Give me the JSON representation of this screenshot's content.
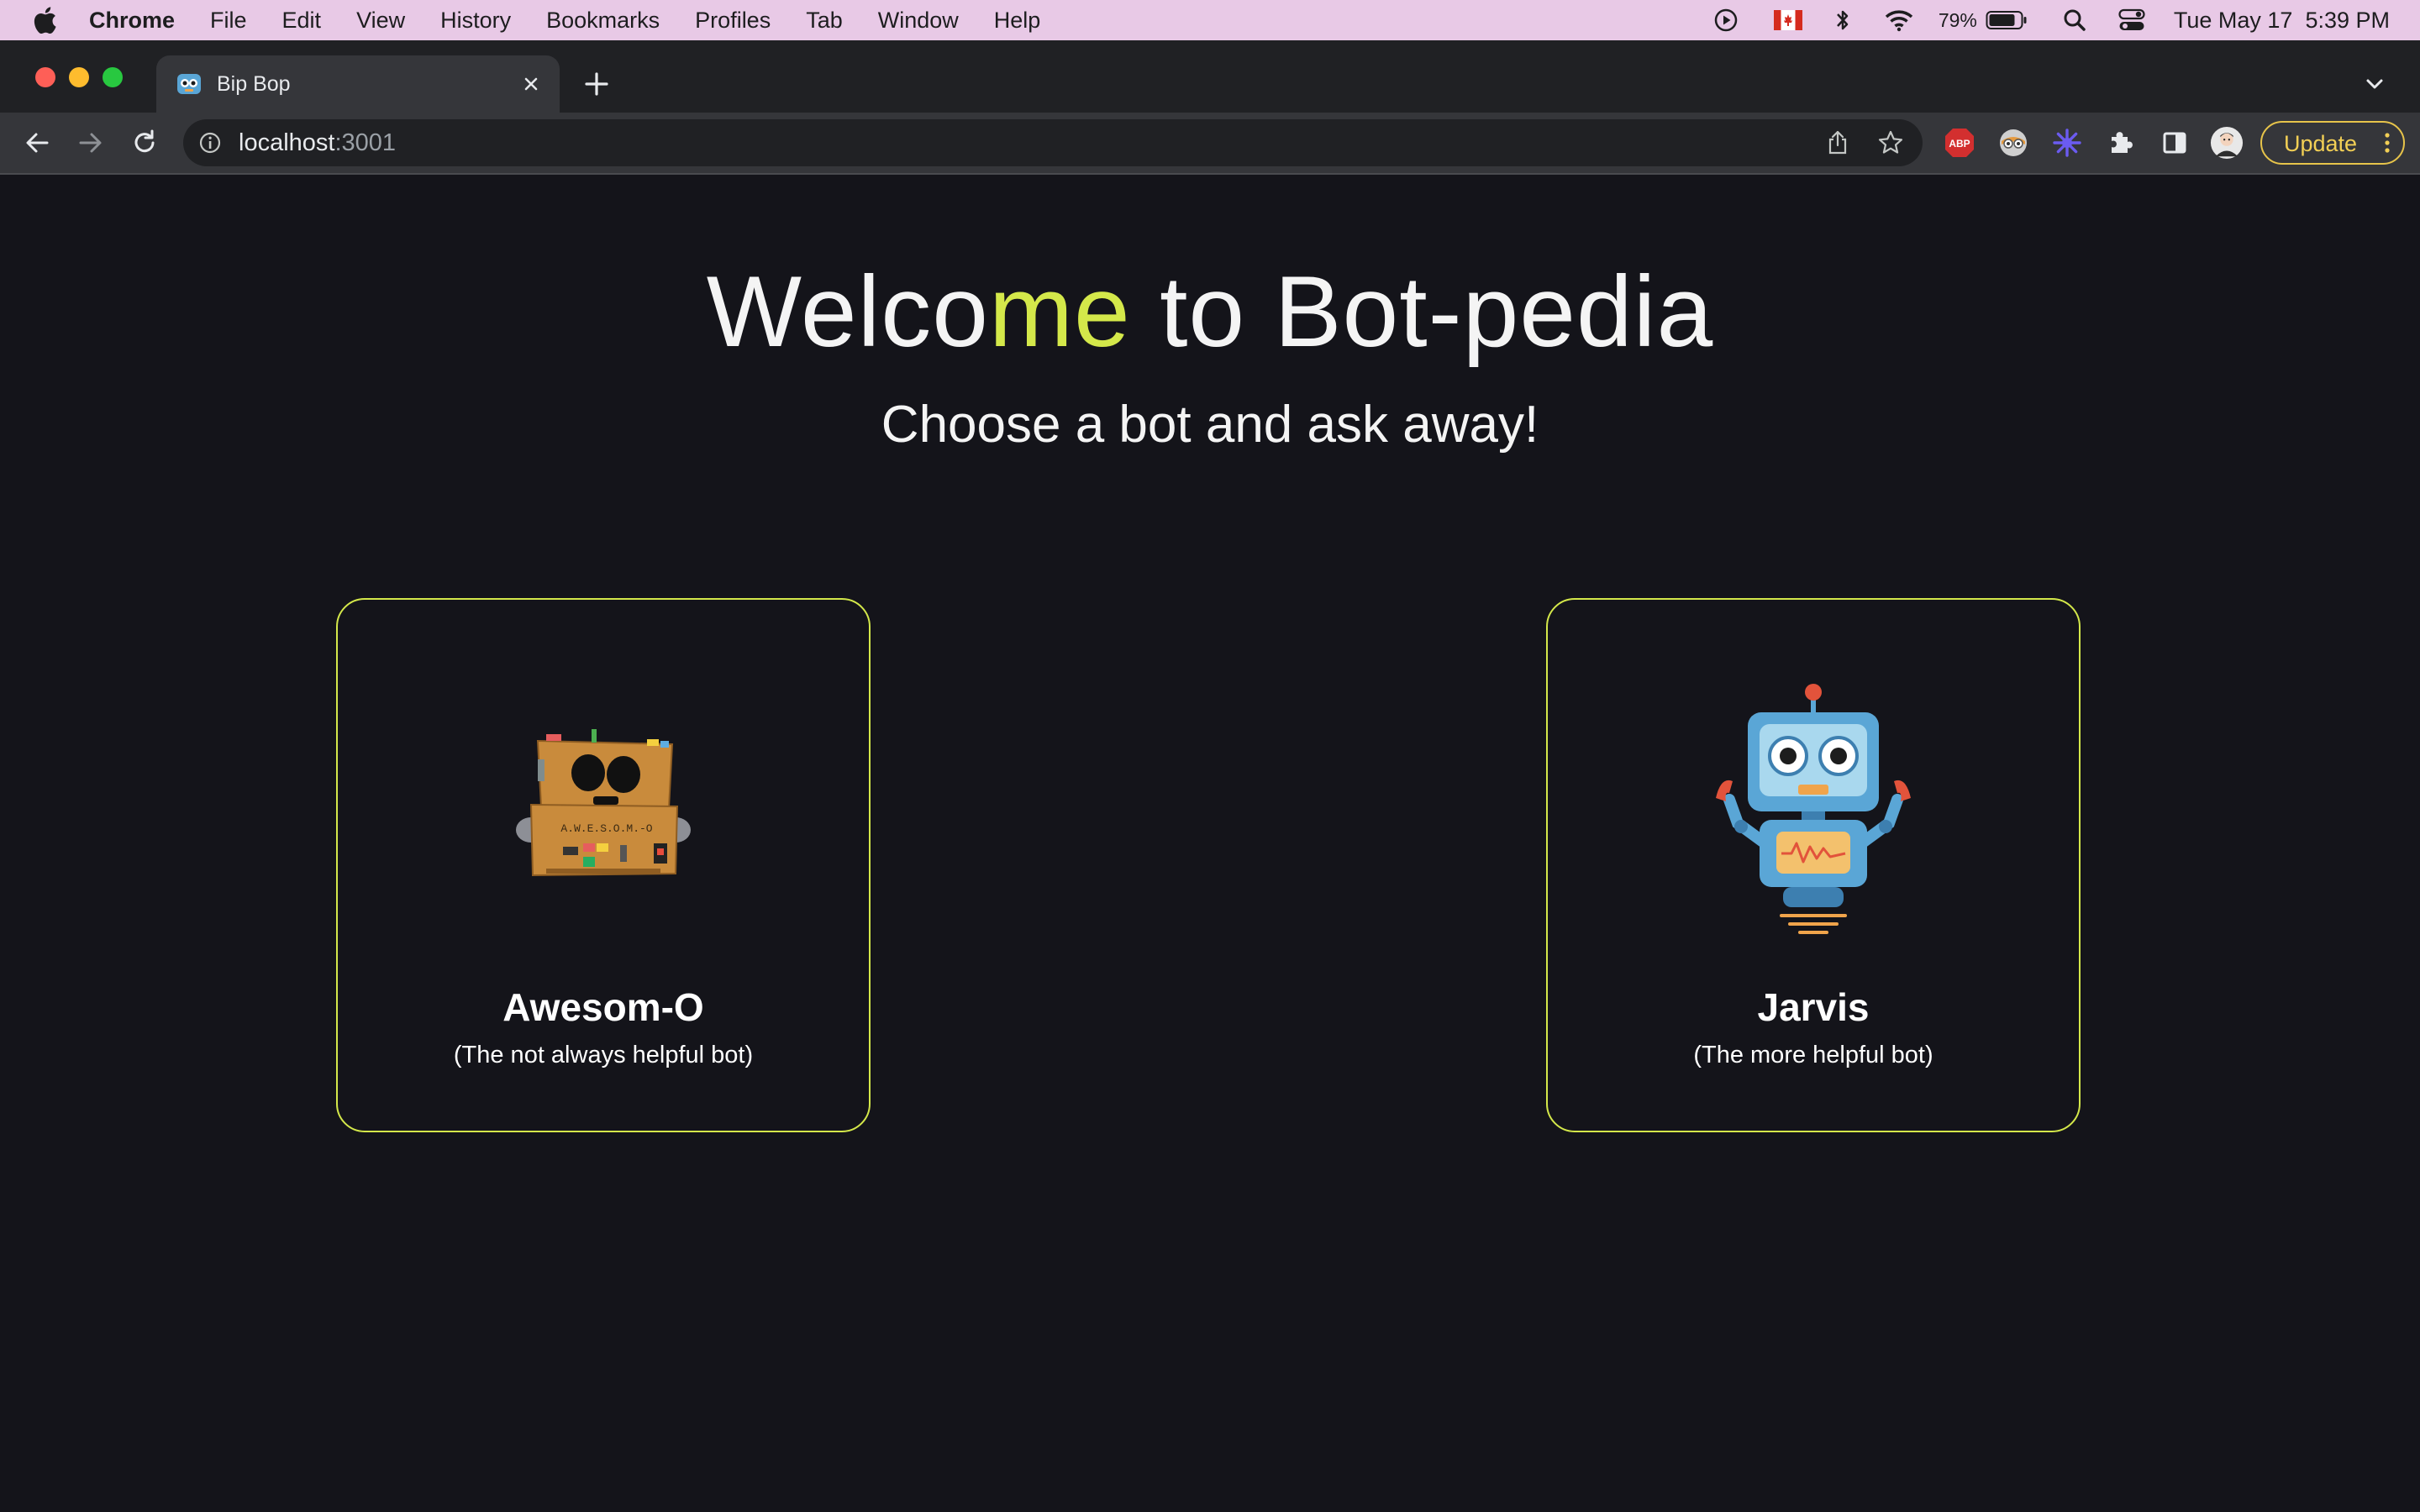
{
  "menubar": {
    "app_name": "Chrome",
    "menus": [
      "File",
      "Edit",
      "View",
      "History",
      "Bookmarks",
      "Profiles",
      "Tab",
      "Window",
      "Help"
    ],
    "battery_percent": "79%",
    "datetime": "Tue May 17  5:39 PM"
  },
  "browser": {
    "tab_title": "Bip Bop",
    "url_host": "localhost",
    "url_port": ":3001",
    "update_label": "Update",
    "extensions": [
      "adblock-plus-icon",
      "profile-extension-icon",
      "sparkle-extension-icon",
      "puzzle-extensions-icon",
      "side-panel-icon"
    ],
    "abp_text": "ABP"
  },
  "page": {
    "title_part1": "Welco",
    "title_highlight": "me",
    "title_part2": " to Bot-pedia",
    "subtitle": "Choose a bot and ask away!",
    "highlight_color": "#d4e84a",
    "bots": [
      {
        "name": "Awesom-O",
        "description": "(The not always helpful bot)",
        "badge_text": "A.W.E.S.O.M.-O"
      },
      {
        "name": "Jarvis",
        "description": "(The more helpful bot)"
      }
    ]
  }
}
